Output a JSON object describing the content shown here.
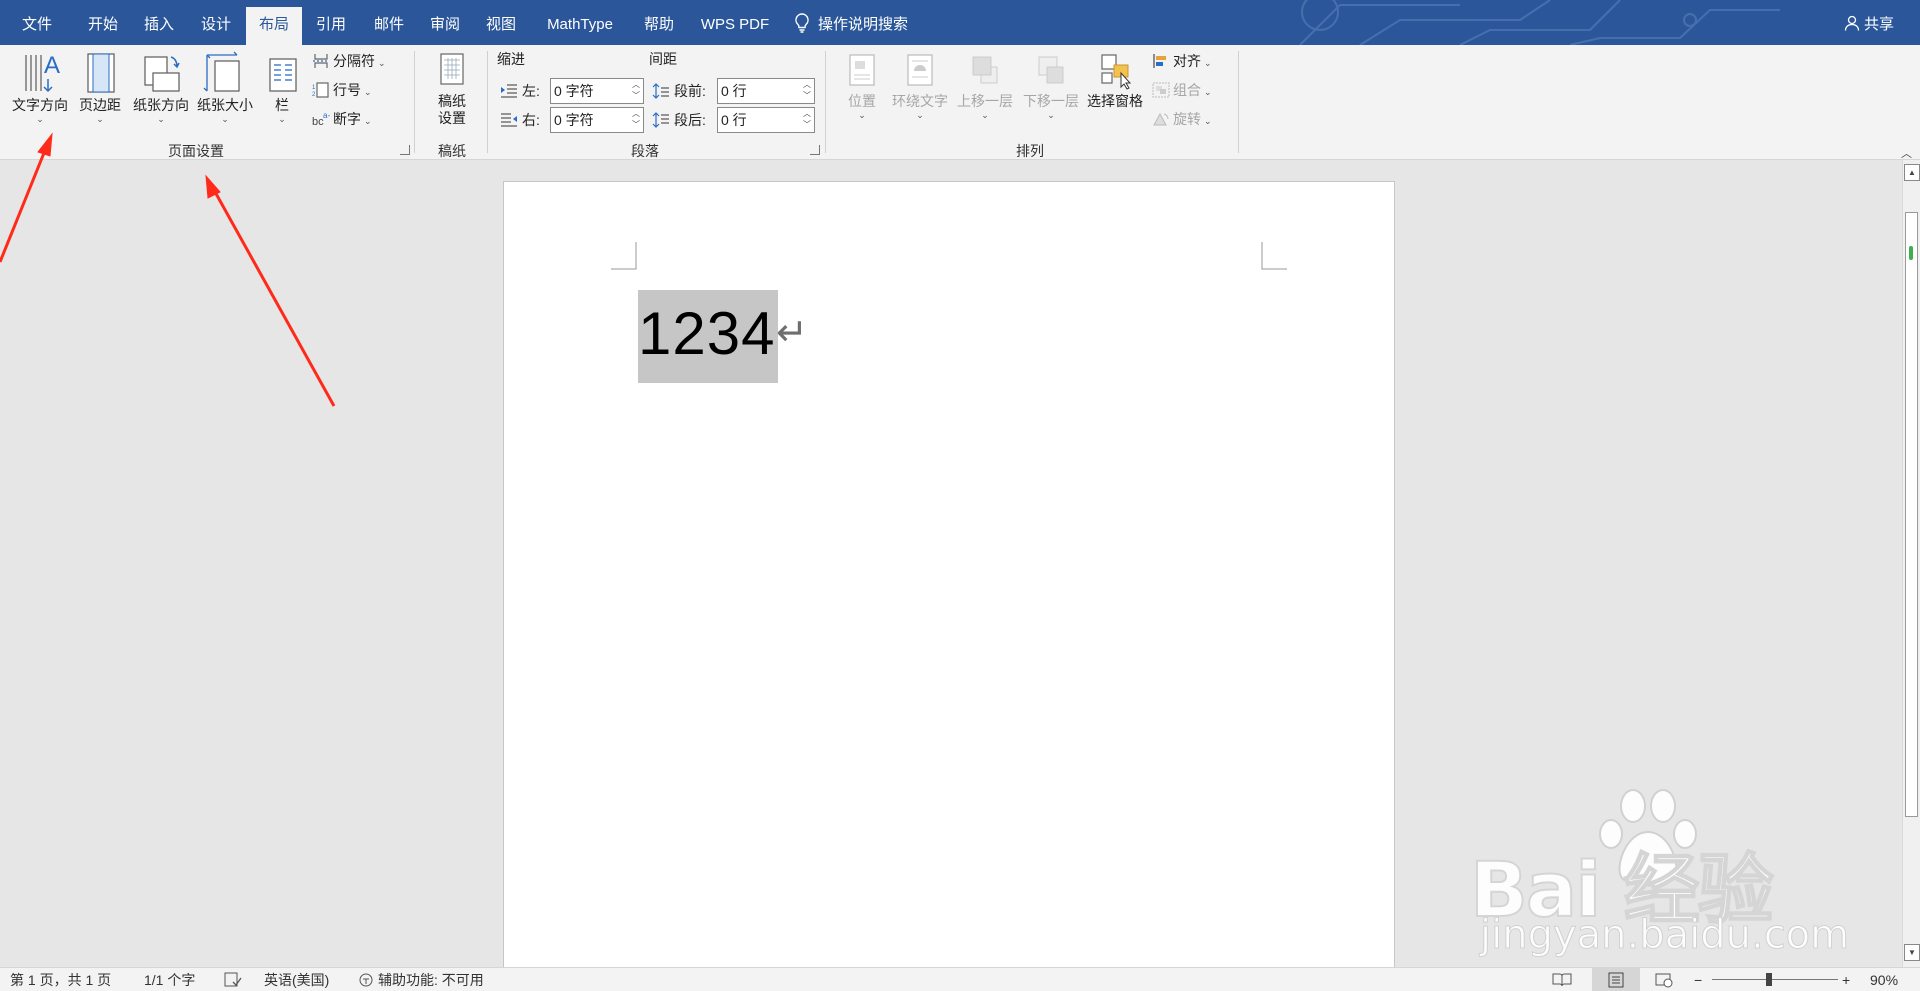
{
  "tabbar": {
    "tabs": [
      "文件",
      "开始",
      "插入",
      "设计",
      "布局",
      "引用",
      "邮件",
      "审阅",
      "视图",
      "MathType",
      "帮助",
      "WPS PDF"
    ],
    "active_tab": "布局",
    "search": "操作说明搜索",
    "share": "共享",
    "colors": {
      "bar": "#2b579a",
      "active_text": "#2b579a"
    }
  },
  "ribbon": {
    "page_setup": {
      "text_direction": "文字方向",
      "margins": "页边距",
      "orientation": "纸张方向",
      "size": "纸张大小",
      "columns": "栏",
      "breaks": "分隔符",
      "line_numbers": "行号",
      "hyphenation": "断字",
      "group": "页面设置"
    },
    "manuscript": {
      "button_line1": "稿纸",
      "button_line2": "设置",
      "group": "稿纸"
    },
    "paragraph": {
      "indent_title": "缩进",
      "spacing_title": "间距",
      "left_label": "左:",
      "left_value": "0 字符",
      "right_label": "右:",
      "right_value": "0 字符",
      "before_label": "段前:",
      "before_value": "0 行",
      "after_label": "段后:",
      "after_value": "0 行",
      "group": "段落"
    },
    "arrange": {
      "position": "位置",
      "wrap_text": "环绕文字",
      "bring_forward": "上移一层",
      "send_backward": "下移一层",
      "selection_pane": "选择窗格",
      "align": "对齐",
      "group_objects": "组合",
      "rotate": "旋转",
      "group": "排列"
    }
  },
  "document": {
    "text": "1234",
    "paragraph_mark": "↵",
    "selection_color": "#c6c6c6"
  },
  "statusbar": {
    "page": "第 1 页，共 1 页",
    "words": "1/1 个字",
    "language": "英语(美国)",
    "accessibility": "辅助功能: 不可用",
    "zoom": "90%",
    "zoom_minus": "−",
    "zoom_plus": "+"
  },
  "watermark": {
    "brand": "Bai  经验",
    "url": "jingyan.baidu.com"
  },
  "annotation_color": "#ff2a1a"
}
